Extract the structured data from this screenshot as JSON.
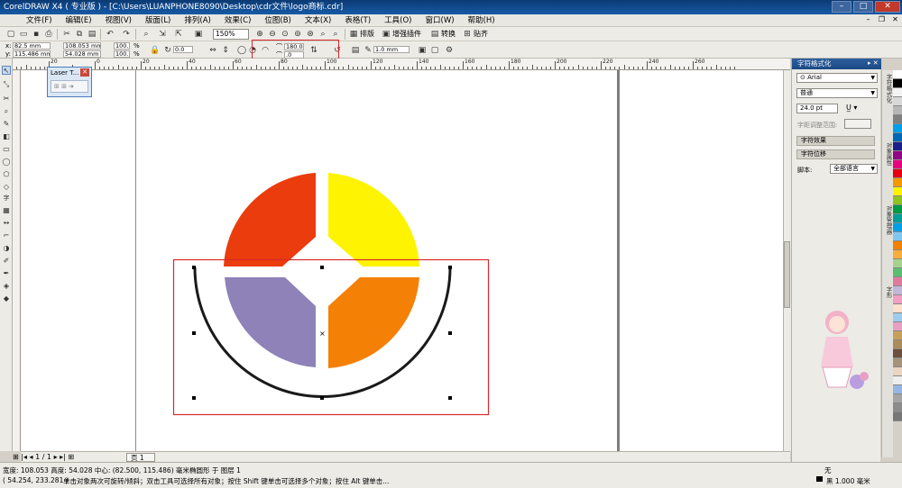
{
  "window": {
    "title": "CorelDRAW X4 ( 专业版 ) - [C:\\Users\\LUANPHONE8090\\Desktop\\cdr文件\\logo商标.cdr]",
    "controls": [
      "–",
      "□",
      "✕"
    ]
  },
  "menu": {
    "items": [
      "文件(F)",
      "编辑(E)",
      "视图(V)",
      "版面(L)",
      "排列(A)",
      "效果(C)",
      "位图(B)",
      "文本(X)",
      "表格(T)",
      "工具(O)",
      "窗口(W)",
      "帮助(H)"
    ],
    "mdi_controls": [
      "–",
      "❐",
      "✕"
    ]
  },
  "toolbar": {
    "zoom_value": "150%",
    "buttons": [
      {
        "name": "new-icon",
        "glyph": "▢"
      },
      {
        "name": "open-icon",
        "glyph": "▭"
      },
      {
        "name": "save-icon",
        "glyph": "▪"
      },
      {
        "name": "print-icon",
        "glyph": "⎙"
      },
      {
        "name": "cut-icon",
        "glyph": "✂"
      },
      {
        "name": "copy-icon",
        "glyph": "⧉"
      },
      {
        "name": "paste-icon",
        "glyph": "▤"
      },
      {
        "name": "undo-icon",
        "glyph": "↶"
      },
      {
        "name": "redo-icon",
        "glyph": "↷"
      },
      {
        "name": "search-icon",
        "glyph": "⌕"
      },
      {
        "name": "import-icon",
        "glyph": "⇲"
      },
      {
        "name": "export-icon",
        "glyph": "⇱"
      },
      {
        "name": "launcher-icon",
        "glyph": "▣"
      }
    ],
    "arrange_label": "排版",
    "plugin_label": "增强插件",
    "convert_label": "转换",
    "align_label": "贴齐"
  },
  "property_bar": {
    "x_label": "x:",
    "x_value": "82.5 mm",
    "y_label": "y:",
    "y_value": "115.486 mm",
    "w_value": "108.053 mm",
    "h_value": "54.028 mm",
    "scale_w": "100.0",
    "scale_h": "100.0",
    "percent": "%",
    "rotation": "0.0",
    "start_angle": "180.0",
    "end_angle": ".0",
    "outline_width": "1.0 mm"
  },
  "ruler": {
    "top_numbers": [
      "40",
      "20",
      "0",
      "20",
      "40",
      "60",
      "80",
      "100",
      "120",
      "140",
      "160",
      "180",
      "200",
      "220",
      "240",
      "260"
    ],
    "unit": "毫米"
  },
  "laser_window": {
    "title": "Laser T...",
    "close": "✕",
    "body": "⊞ ⊞ ➜"
  },
  "docker": {
    "title": "字符格式化",
    "font": "Arial",
    "style": "普通",
    "size": "24.0 pt",
    "range_label": "字距调整范围:",
    "section_effects": "字符效果",
    "section_offset": "字符位移",
    "script_label": "脚本:",
    "script_value": "全部语言"
  },
  "side_tabs": [
    "字符格式化",
    "对象属性",
    "对象管理器",
    "字形"
  ],
  "palette_colors": [
    "#ffffff",
    "#000000",
    "#f4f4f4",
    "#d8d8d8",
    "#b7b7b7",
    "#808080",
    "#00a0e9",
    "#0068b7",
    "#1d2088",
    "#920783",
    "#e4007f",
    "#e60012",
    "#f39800",
    "#fff100",
    "#8fc31f",
    "#009944",
    "#009e96",
    "#00a0e9",
    "#7fc7ef",
    "#ef8200",
    "#f6ad3c",
    "#a7d28d",
    "#5bbd72",
    "#dd7b9f",
    "#c2b7d9",
    "#f19ec2",
    "#ffe0cc",
    "#9dccec",
    "#e7a0c3",
    "#c7a15b",
    "#ad8c5b",
    "#6c4f3d",
    "#a6937c",
    "#ebd5c1",
    "#eeeeee",
    "#95b6e4",
    "#a5a5a5",
    "#8c8c8c",
    "#777777"
  ],
  "canvas": {
    "shape_colors": {
      "top_left": "#ea3c0c",
      "top_right": "#fef300",
      "bottom_left": "#8e82b8",
      "bottom_right": "#f58006",
      "arc": "#1a1a1a",
      "selection_box": "#d9282b"
    }
  },
  "status": {
    "dimensions": "宽度: 108.053  高度: 54.028  中心: (82.500, 115.486)  毫米",
    "object_info": "椭圆形 于 图层 1",
    "cursor": "( 54.254, 233.281 )",
    "hint": "单击对象两次可旋转/倾斜；双击工具可选择所有对象；按住 Shift 键单击可选择多个对象；按住 Alt 键单击...",
    "page_count": "1 / 1",
    "page_label": "页 1",
    "fill_label": "无",
    "outline_label": "黑  1.000 毫米"
  }
}
